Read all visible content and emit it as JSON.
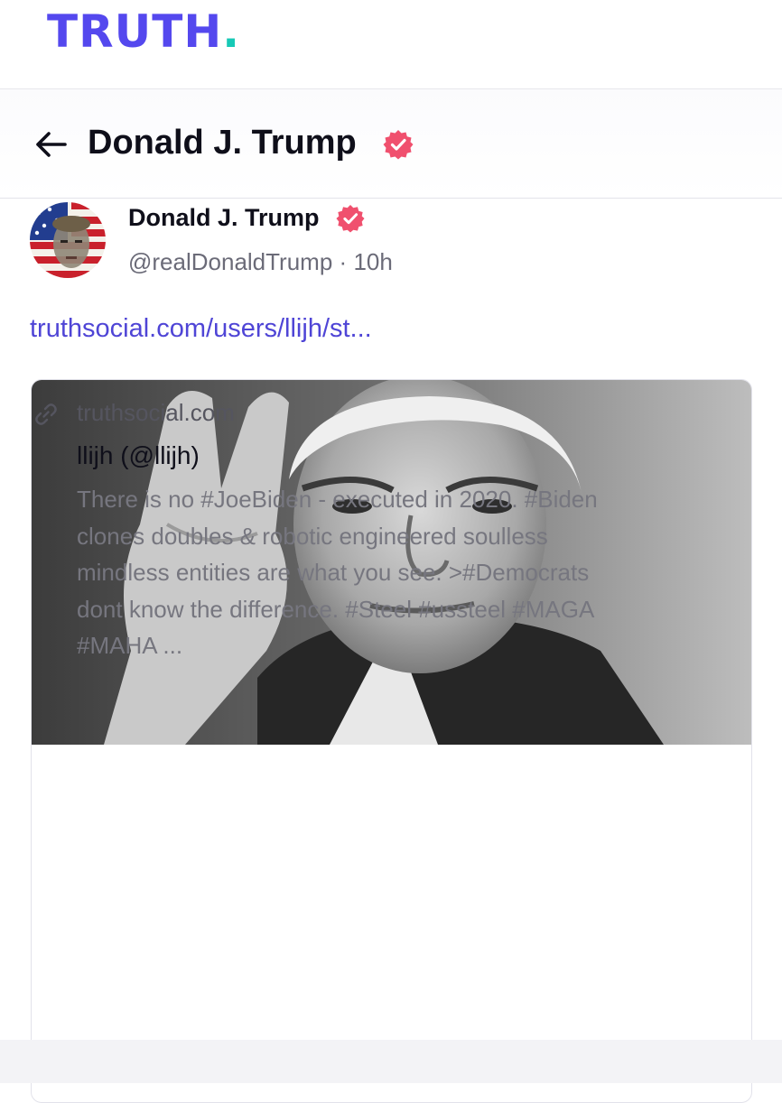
{
  "app": {
    "logo_text": "TRUTH",
    "logo_dot": ".",
    "brand_color": "#5448ee",
    "accent_color": "#17c9b6",
    "verified_color": "#f0506e"
  },
  "header": {
    "back_icon": "arrow-left-icon",
    "title": "Donald J. Trump",
    "verified_icon": "verified-badge-icon"
  },
  "post": {
    "author_name": "Donald J. Trump",
    "handle": "@realDonaldTrump",
    "separator": "·",
    "time": "10h",
    "link_text": "truthsocial.com/users/llijh/st...",
    "card": {
      "link_icon": "link-icon",
      "domain": "truthsocial.com",
      "title": "llijh (@llijh)",
      "description_lines": [
        "There is no #JoeBiden - executed in 2020. #Biden",
        "clones doubles & robotic engineered soulless",
        "mindless entities are what you see. >#Democrats",
        "dont know the difference. #Steel #ussteel #MAGA",
        "#MAHA ..."
      ]
    }
  }
}
